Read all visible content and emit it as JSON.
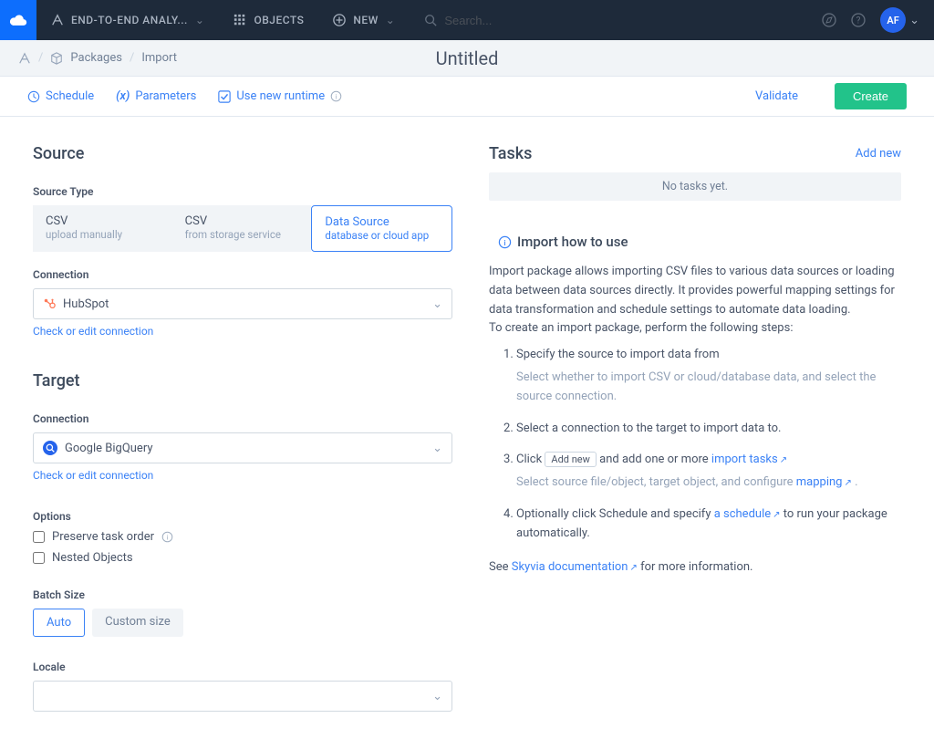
{
  "nav": {
    "workspace": "END-TO-END ANALY...",
    "objects": "OBJECTS",
    "new": "NEW",
    "search_placeholder": "Search...",
    "avatar": "AF"
  },
  "breadcrumb": {
    "packages": "Packages",
    "current": "Import",
    "title": "Untitled"
  },
  "toolbar": {
    "schedule": "Schedule",
    "parameters": "Parameters",
    "runtime": "Use new runtime",
    "validate": "Validate",
    "create": "Create"
  },
  "source": {
    "heading": "Source",
    "type_label": "Source Type",
    "tiles": [
      {
        "t1": "CSV",
        "t2": "upload manually"
      },
      {
        "t1": "CSV",
        "t2": "from storage service"
      },
      {
        "t1": "Data Source",
        "t2": "database or cloud app"
      }
    ],
    "conn_label": "Connection",
    "conn_value": "HubSpot",
    "check_edit": "Check or edit",
    "connection_word": " connection"
  },
  "target": {
    "heading": "Target",
    "conn_label": "Connection",
    "conn_value": "Google BigQuery",
    "check_edit": "Check or edit",
    "connection_word": " connection"
  },
  "options": {
    "label": "Options",
    "preserve": "Preserve task order",
    "nested": "Nested Objects"
  },
  "batch": {
    "label": "Batch Size",
    "auto": "Auto",
    "custom": "Custom size"
  },
  "locale": {
    "label": "Locale"
  },
  "tasks": {
    "heading": "Tasks",
    "add_new": "Add new",
    "empty": "No tasks yet."
  },
  "howto": {
    "title": "Import how to use",
    "para1": "Import package allows importing CSV files to various data sources or loading data between data sources directly. It provides powerful mapping settings for data transformation and schedule settings to automate data loading.",
    "para2": "To create an import package, perform the following steps:",
    "step1": "Specify the source to import data from",
    "step1_sub": "Select whether to import CSV or cloud/database data, and select the source connection.",
    "step2": "Select a connection to the target to import data to.",
    "step3a": "Click",
    "step3_btn": "Add new",
    "step3b": "and add one or more",
    "step3_link": "import tasks",
    "step3_sub_a": "Select source file/object, target object, and configure",
    "step3_sub_link": "mapping",
    "step4a": "Optionally click Schedule and specify",
    "step4_link": "a schedule",
    "step4b": "to run your package automatically.",
    "see": "See",
    "doc_link": "Skyvia documentation",
    "more": "for more information."
  }
}
